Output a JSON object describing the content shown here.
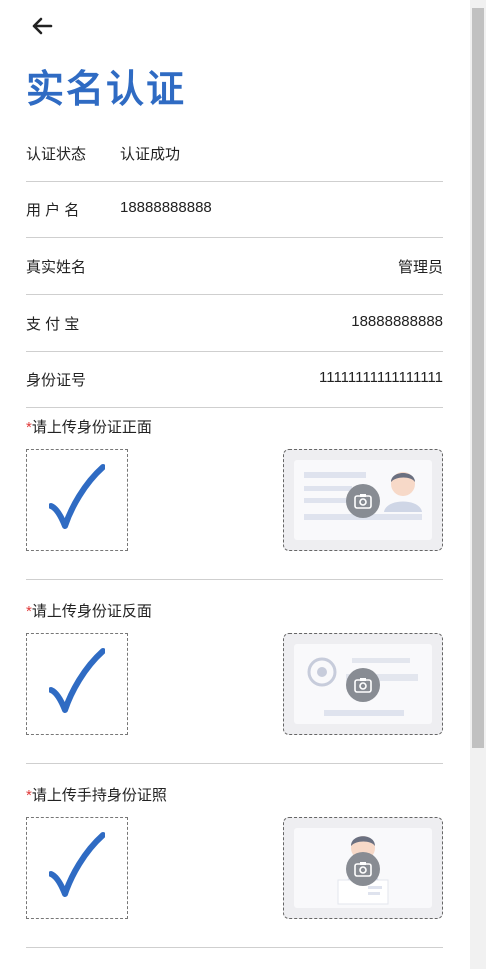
{
  "header": {
    "back_icon": "arrow-left-icon",
    "title": "实名认证"
  },
  "fields": [
    {
      "label": "认证状态",
      "value": "认证成功",
      "align": "left"
    },
    {
      "label": "用 户 名",
      "value": "18888888888",
      "align": "left"
    },
    {
      "label": "真实姓名",
      "value": "管理员",
      "align": "right"
    },
    {
      "label": "支 付 宝",
      "value": "18888888888",
      "align": "right"
    },
    {
      "label": "身份证号",
      "value": "11111111111111111",
      "align": "right"
    }
  ],
  "uploads": [
    {
      "required_mark": "*",
      "label": "请上传身份证正面",
      "status": "uploaded",
      "sample": "id-card-front"
    },
    {
      "required_mark": "*",
      "label": "请上传身份证反面",
      "status": "uploaded",
      "sample": "id-card-back"
    },
    {
      "required_mark": "*",
      "label": "请上传手持身份证照",
      "status": "uploaded",
      "sample": "id-card-handheld"
    }
  ],
  "colors": {
    "accent": "#2f6bc3",
    "required": "#e03a3a"
  }
}
